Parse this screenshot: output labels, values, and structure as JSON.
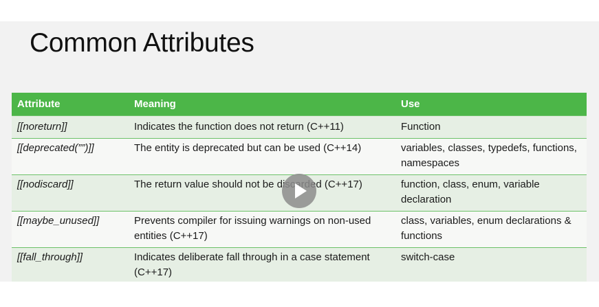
{
  "slide": {
    "title": "Common Attributes"
  },
  "table": {
    "headers": [
      "Attribute",
      "Meaning",
      "Use"
    ],
    "rows": [
      {
        "attribute": "[[noreturn]]",
        "meaning": "Indicates the function does not return (C++11)",
        "use": "Function"
      },
      {
        "attribute": "[[deprecated(””)]]",
        "meaning": "The entity is deprecated but can be used (C++14)",
        "use": "variables, classes, typedefs, functions, namespaces"
      },
      {
        "attribute": "[[nodiscard]]",
        "meaning": "The return value should not be discarded (C++17)",
        "use": "function, class, enum, variable declaration"
      },
      {
        "attribute": "[[maybe_unused]]",
        "meaning": "Prevents compiler for issuing warnings on non-used entities (C++17)",
        "use": "class, variables, enum declarations & functions"
      },
      {
        "attribute": "[[fall_through]]",
        "meaning": "Indicates deliberate fall through in a case statement (C++17)",
        "use": "switch-case"
      }
    ]
  },
  "colors": {
    "header_green": "#4cb648",
    "row_tint": "#e6efe4",
    "row_light": "#f7f8f6",
    "slide_bg": "#f2f2f2"
  },
  "icons": {
    "play": "play-icon"
  }
}
